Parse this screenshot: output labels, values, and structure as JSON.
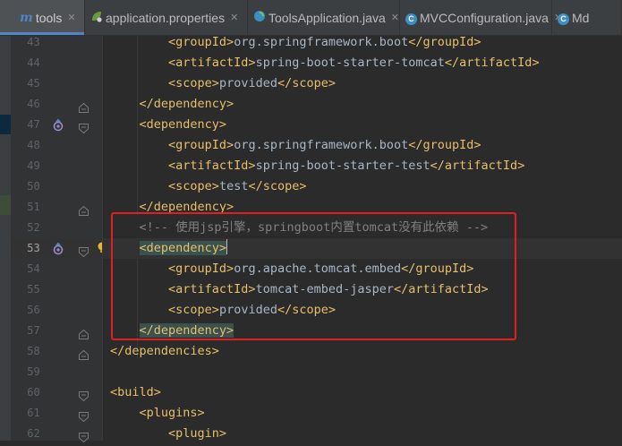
{
  "tabs": [
    {
      "label": "tools",
      "icon": "maven-module-icon",
      "active": true
    },
    {
      "label": "application.properties",
      "icon": "spring-leaf-icon",
      "active": false
    },
    {
      "label": "ToolsApplication.java",
      "icon": "spring-class-icon",
      "active": false
    },
    {
      "label": "MVCConfiguration.java",
      "icon": "class-icon",
      "active": false
    },
    {
      "label": "Md",
      "icon": "class-icon",
      "active": false
    }
  ],
  "tab_icon_letters": {
    "maven": "m",
    "class": "C"
  },
  "lines": [
    {
      "num": "43",
      "code": "        <groupId>org.springframework.boot</groupId>"
    },
    {
      "num": "44",
      "code": "        <artifactId>spring-boot-starter-tomcat</artifactId>"
    },
    {
      "num": "45",
      "code": "        <scope>provided</scope>"
    },
    {
      "num": "46",
      "code": "    </dependency>"
    },
    {
      "num": "47",
      "code": "    <dependency>"
    },
    {
      "num": "48",
      "code": "        <groupId>org.springframework.boot</groupId>"
    },
    {
      "num": "49",
      "code": "        <artifactId>spring-boot-starter-test</artifactId>"
    },
    {
      "num": "50",
      "code": "        <scope>test</scope>"
    },
    {
      "num": "51",
      "code": "    </dependency>"
    },
    {
      "num": "52",
      "code": "    <!-- 使用jsp引擎，springboot内置tomcat没有此依赖 -->"
    },
    {
      "num": "53",
      "code": "    <dependency>"
    },
    {
      "num": "54",
      "code": "        <groupId>org.apache.tomcat.embed</groupId>"
    },
    {
      "num": "55",
      "code": "        <artifactId>tomcat-embed-jasper</artifactId>"
    },
    {
      "num": "56",
      "code": "        <scope>provided</scope>"
    },
    {
      "num": "57",
      "code": "    </dependency>"
    },
    {
      "num": "58",
      "code": "</dependencies>"
    },
    {
      "num": "59",
      "code": ""
    },
    {
      "num": "60",
      "code": "<build>"
    },
    {
      "num": "61",
      "code": "    <plugins>"
    },
    {
      "num": "62",
      "code": "        <plugin>"
    }
  ],
  "current_line": "53",
  "colors": {
    "tag": "#e8bf6a",
    "text": "#a9b7c6",
    "comment": "#808080",
    "annotation_box": "#e02020"
  }
}
